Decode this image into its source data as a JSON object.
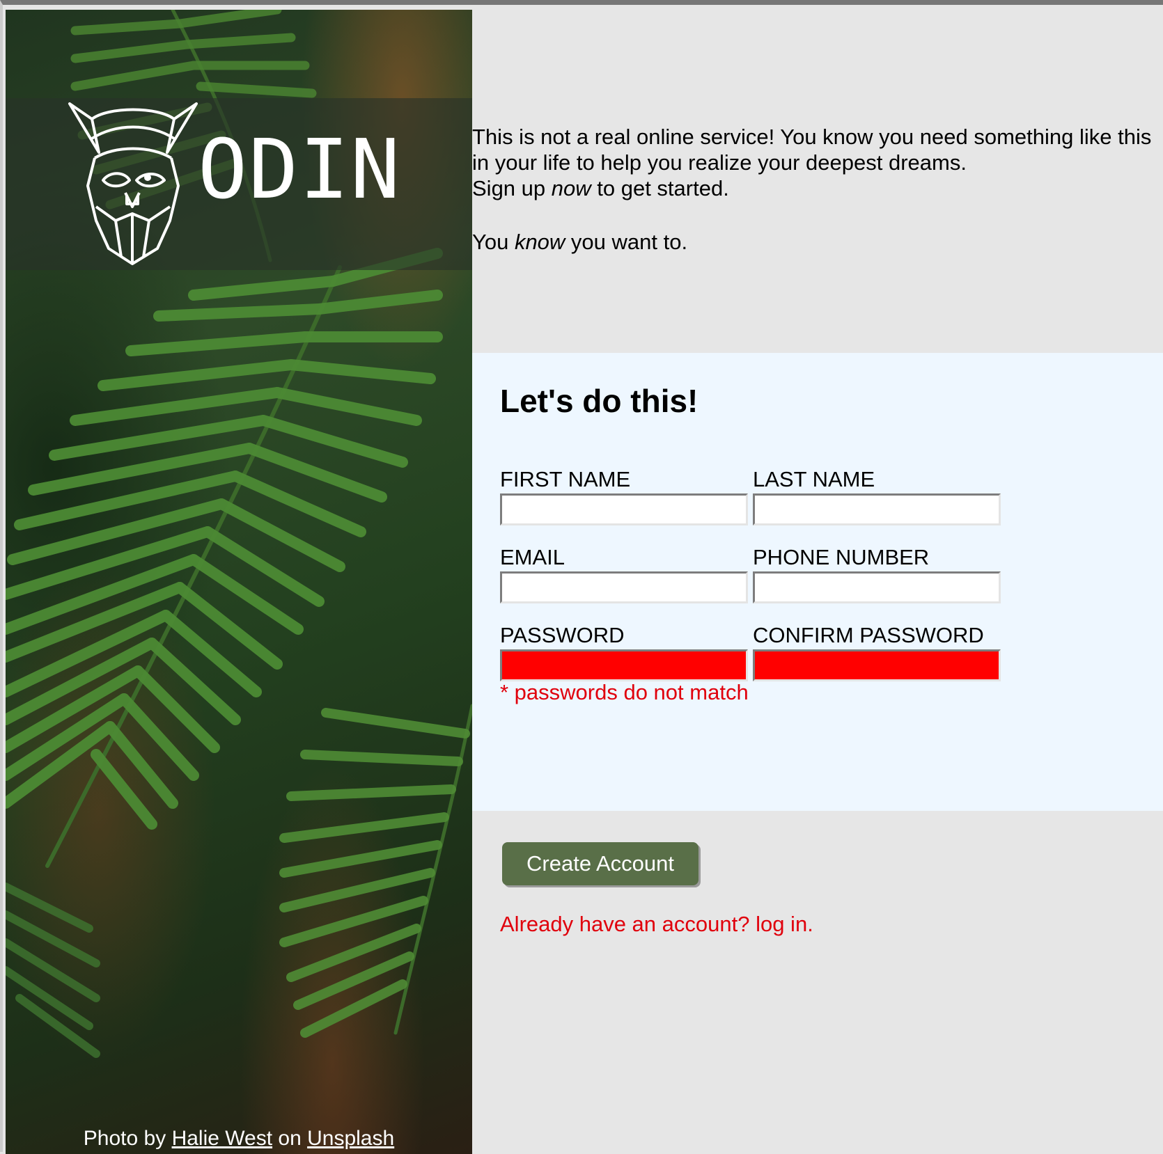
{
  "brand": {
    "logo_text": "ODIN"
  },
  "hero": {
    "credit_prefix": "Photo by ",
    "credit_author": "Halie West",
    "credit_middle": " on ",
    "credit_site": "Unsplash"
  },
  "intro": {
    "line1": "This is not a real online service! You know you need something like this in your life to help you realize your deepest dreams.",
    "line2_before": "Sign up ",
    "line2_em": "now",
    "line2_after": " to get started.",
    "line3_before": "You ",
    "line3_em": "know",
    "line3_after": " you want to."
  },
  "form": {
    "heading": "Let's do this!",
    "fields": {
      "first_name": {
        "label": "FIRST NAME",
        "value": ""
      },
      "last_name": {
        "label": "LAST NAME",
        "value": ""
      },
      "email": {
        "label": "EMAIL",
        "value": ""
      },
      "phone": {
        "label": "PHONE NUMBER",
        "value": ""
      },
      "password": {
        "label": "PASSWORD",
        "value": ""
      },
      "confirm_password": {
        "label": "CONFIRM PASSWORD",
        "value": ""
      }
    },
    "error": "* passwords do not match"
  },
  "actions": {
    "create_label": "Create Account",
    "login_text": "Already have an account? log in."
  },
  "colors": {
    "button_bg": "#596f48",
    "error": "#e0000c",
    "invalid_input": "#ff0000",
    "form_bg": "#eef7ff",
    "page_bg": "#e6e6e6"
  }
}
